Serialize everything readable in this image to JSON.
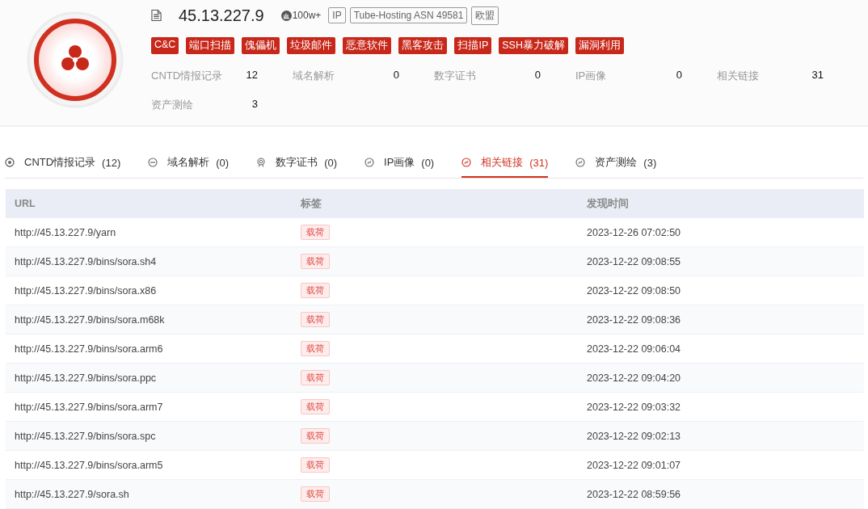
{
  "header": {
    "ip": "45.13.227.9",
    "popularity": "100w+",
    "badges": [
      "IP",
      "Tube-Hosting ASN 49581",
      "欧盟"
    ],
    "tags": [
      "C&C",
      "端口扫描",
      "傀儡机",
      "垃圾邮件",
      "恶意软件",
      "黑客攻击",
      "扫描IP",
      "SSH暴力破解",
      "漏洞利用"
    ],
    "stats": [
      {
        "label": "CNTD情报记录",
        "value": "12"
      },
      {
        "label": "域名解析",
        "value": "0"
      },
      {
        "label": "数字证书",
        "value": "0"
      },
      {
        "label": "IP画像",
        "value": "0"
      },
      {
        "label": "相关链接",
        "value": "31"
      },
      {
        "label": "资产测绘",
        "value": "3"
      }
    ]
  },
  "tabs": [
    {
      "label": "CNTD情报记录",
      "count": "(12)",
      "kind": "intel",
      "selected": false
    },
    {
      "label": "域名解析",
      "count": "(0)",
      "kind": "domain",
      "selected": false
    },
    {
      "label": "数字证书",
      "count": "(0)",
      "kind": "cert",
      "selected": false
    },
    {
      "label": "IP画像",
      "count": "(0)",
      "kind": "link",
      "selected": false
    },
    {
      "label": "相关链接",
      "count": "(31)",
      "kind": "link",
      "selected": true
    },
    {
      "label": "资产测绘",
      "count": "(3)",
      "kind": "link",
      "selected": false
    }
  ],
  "table": {
    "columns": [
      "URL",
      "标签",
      "发现时间"
    ],
    "rows": [
      {
        "url": "http://45.13.227.9/yarn",
        "tag": "载荷",
        "time": "2023-12-26 07:02:50"
      },
      {
        "url": "http://45.13.227.9/bins/sora.sh4",
        "tag": "载荷",
        "time": "2023-12-22 09:08:55"
      },
      {
        "url": "http://45.13.227.9/bins/sora.x86",
        "tag": "载荷",
        "time": "2023-12-22 09:08:50"
      },
      {
        "url": "http://45.13.227.9/bins/sora.m68k",
        "tag": "载荷",
        "time": "2023-12-22 09:08:36"
      },
      {
        "url": "http://45.13.227.9/bins/sora.arm6",
        "tag": "载荷",
        "time": "2023-12-22 09:06:04"
      },
      {
        "url": "http://45.13.227.9/bins/sora.ppc",
        "tag": "载荷",
        "time": "2023-12-22 09:04:20"
      },
      {
        "url": "http://45.13.227.9/bins/sora.arm7",
        "tag": "载荷",
        "time": "2023-12-22 09:03:32"
      },
      {
        "url": "http://45.13.227.9/bins/sora.spc",
        "tag": "载荷",
        "time": "2023-12-22 09:02:13"
      },
      {
        "url": "http://45.13.227.9/bins/sora.arm5",
        "tag": "载荷",
        "time": "2023-12-22 09:01:07"
      },
      {
        "url": "http://45.13.227.9/sora.sh",
        "tag": "载荷",
        "time": "2023-12-22 08:59:56"
      }
    ]
  }
}
